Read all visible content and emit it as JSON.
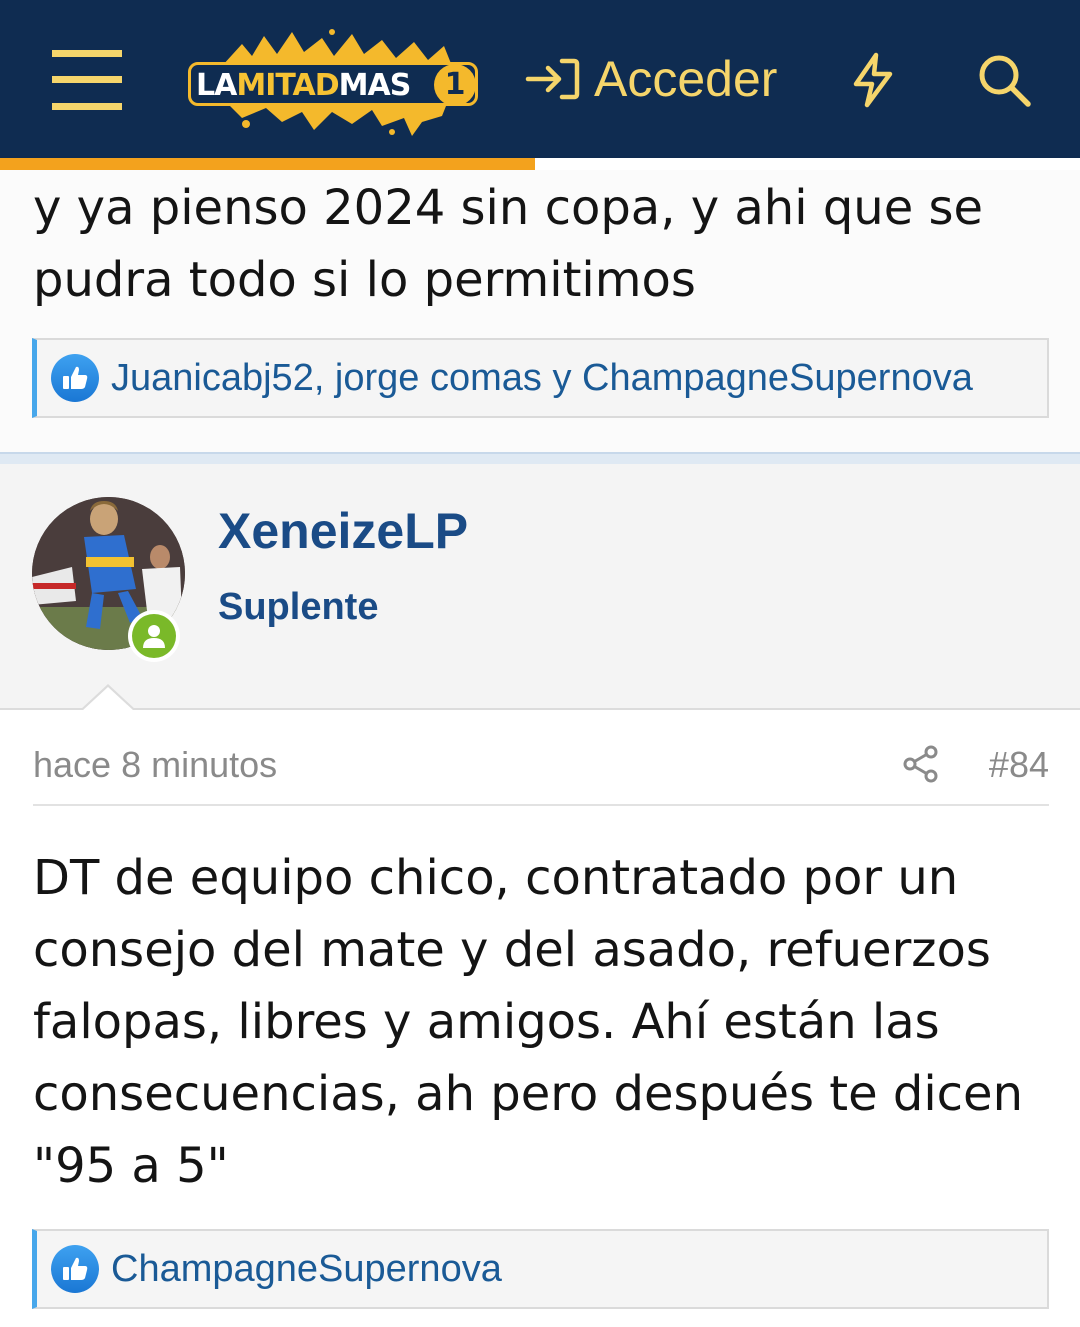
{
  "header": {
    "logo_text_left": "LA",
    "logo_text_mid": "MITAD",
    "logo_text_right": "MAS",
    "logo_number": "1",
    "login_label": "Acceder",
    "reading_progress_percent": 49.5
  },
  "previous_post": {
    "body": "y ya pienso 2024 sin copa, y ahi que se pudra todo si lo permitimos",
    "reactions": "Juanicabj52, jorge comas y ChampagneSupernova"
  },
  "post": {
    "username": "XeneizeLP",
    "user_title": "Suplente",
    "time": "hace 8 minutos",
    "number": "#84",
    "body": "DT de equipo chico, contratado por un consejo del mate y del asado, refuerzos falopas, libres y amigos. Ahí están las consecuencias, ah pero después te dicen \"95 a 5\"",
    "reactions": "ChampagneSupernova"
  },
  "colors": {
    "header_bg": "#0f2c51",
    "accent_yellow": "#f5d56b",
    "progress_orange": "#f3a21d",
    "link_blue": "#1a4b86",
    "online_green": "#7ab929"
  },
  "icons": {
    "menu": "hamburger-icon",
    "login": "sign-in-icon",
    "whats_new": "bolt-icon",
    "search": "search-icon",
    "reaction": "like-icon",
    "share": "share-icon",
    "online": "user-online-icon"
  }
}
